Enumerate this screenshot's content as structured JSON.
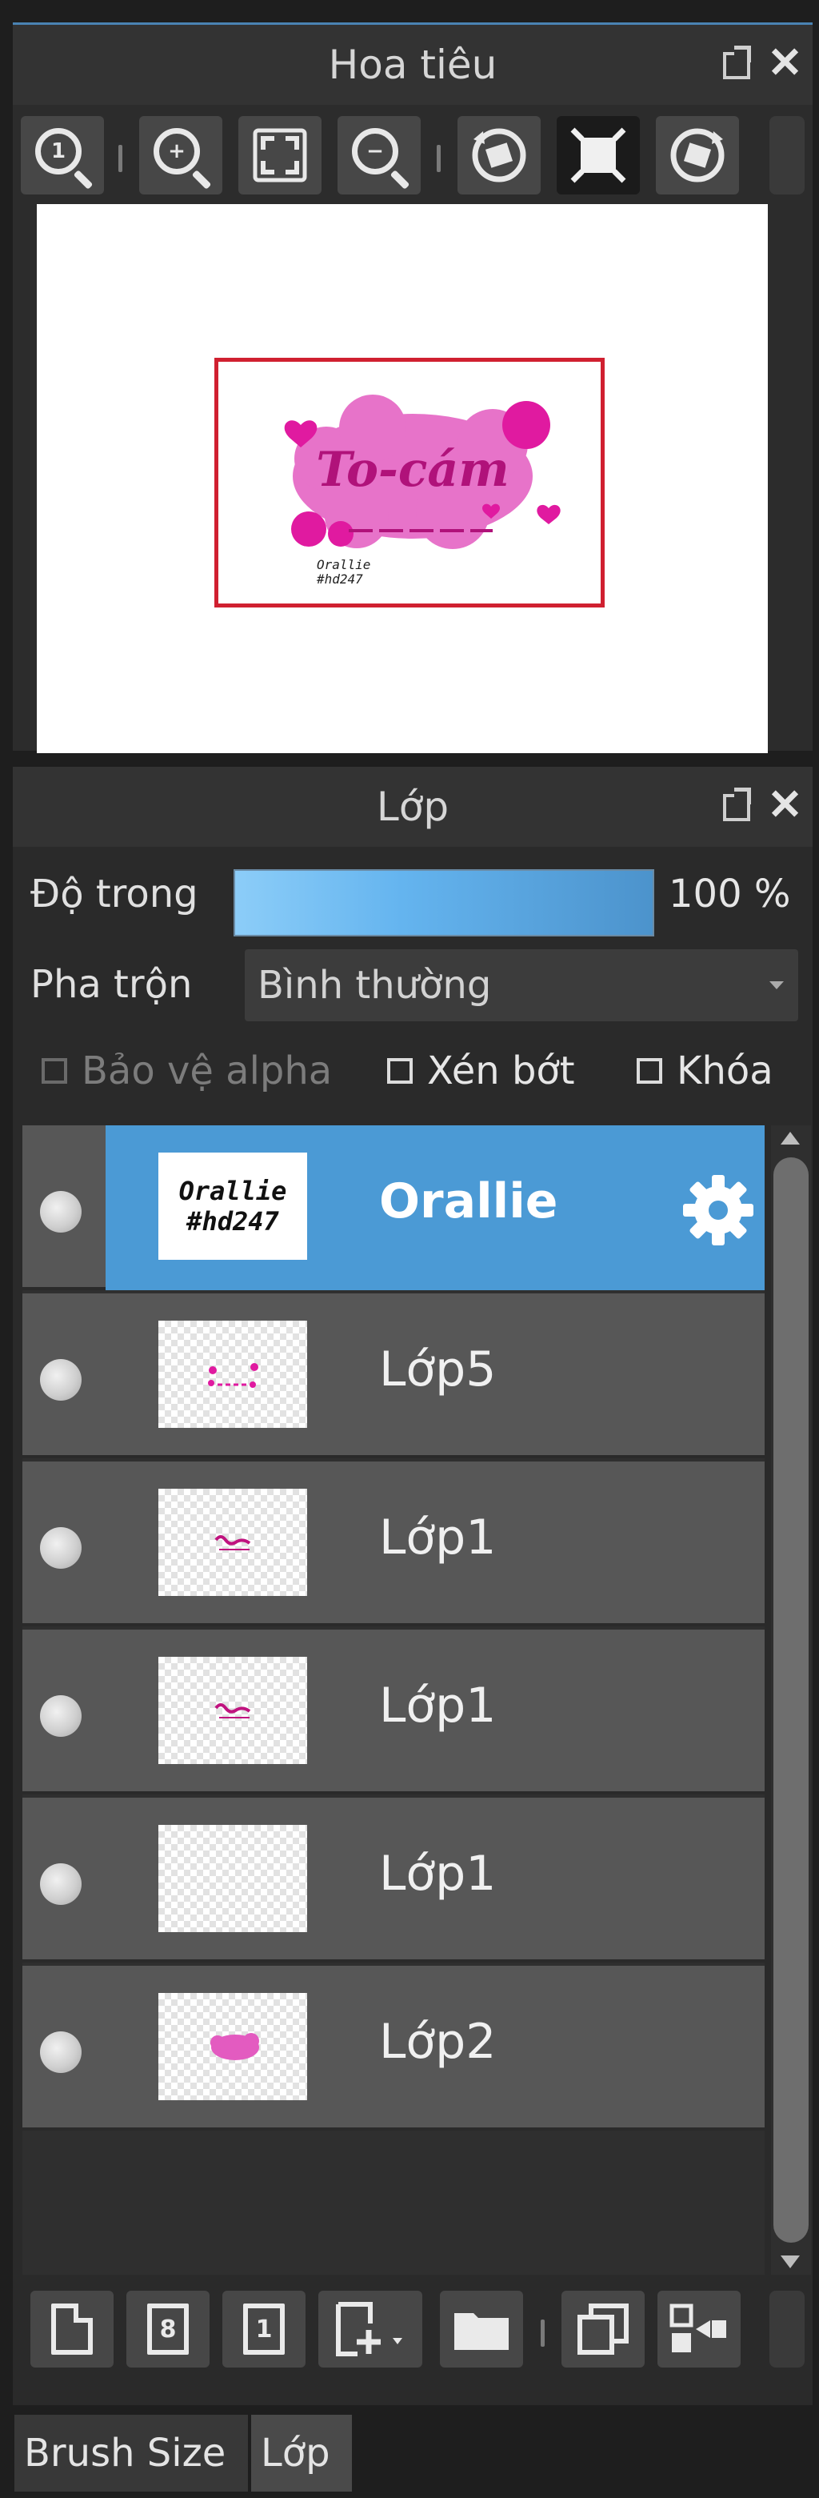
{
  "navigator": {
    "title": "Hoa tiêu",
    "toolbar": [
      {
        "name": "zoom-actual-icon",
        "glyph": "1"
      },
      {
        "name": "zoom-in-icon",
        "glyph": "+"
      },
      {
        "name": "fit-screen-icon"
      },
      {
        "name": "zoom-out-icon",
        "glyph": "−"
      },
      {
        "name": "rotate-left-icon"
      },
      {
        "name": "fit-frame-icon",
        "active": true
      },
      {
        "name": "rotate-right-icon"
      }
    ],
    "preview": {
      "artwork_text": "To-cám",
      "small_text_1": "Orallie",
      "small_text_2": "#hd247"
    }
  },
  "layers": {
    "title": "Lớp",
    "opacity": {
      "label": "Độ trong",
      "value": "100 %",
      "level": 1.0
    },
    "blend": {
      "label": "Pha trộn",
      "value": "Bình thường"
    },
    "checks": {
      "alpha_protect": "Bảo vệ alpha",
      "clipping": "Xén bớt",
      "lock": "Khóa"
    },
    "items": [
      {
        "name": "Orallie",
        "thumb_line1": "Orallie",
        "thumb_line2": "#hd247",
        "selected": true
      },
      {
        "name": "Lớp5"
      },
      {
        "name": "Lớp1"
      },
      {
        "name": "Lớp1"
      },
      {
        "name": "Lớp1"
      },
      {
        "name": "Lớp2"
      }
    ]
  },
  "tabs": [
    {
      "label": "Brush Size",
      "active": false
    },
    {
      "label": "Lớp",
      "active": true
    }
  ],
  "colors": {
    "accent": "#4b9ad5",
    "frame": "#d02030",
    "artwork_pink": "#e35bc0",
    "artwork_magenta": "#e01aa0"
  }
}
